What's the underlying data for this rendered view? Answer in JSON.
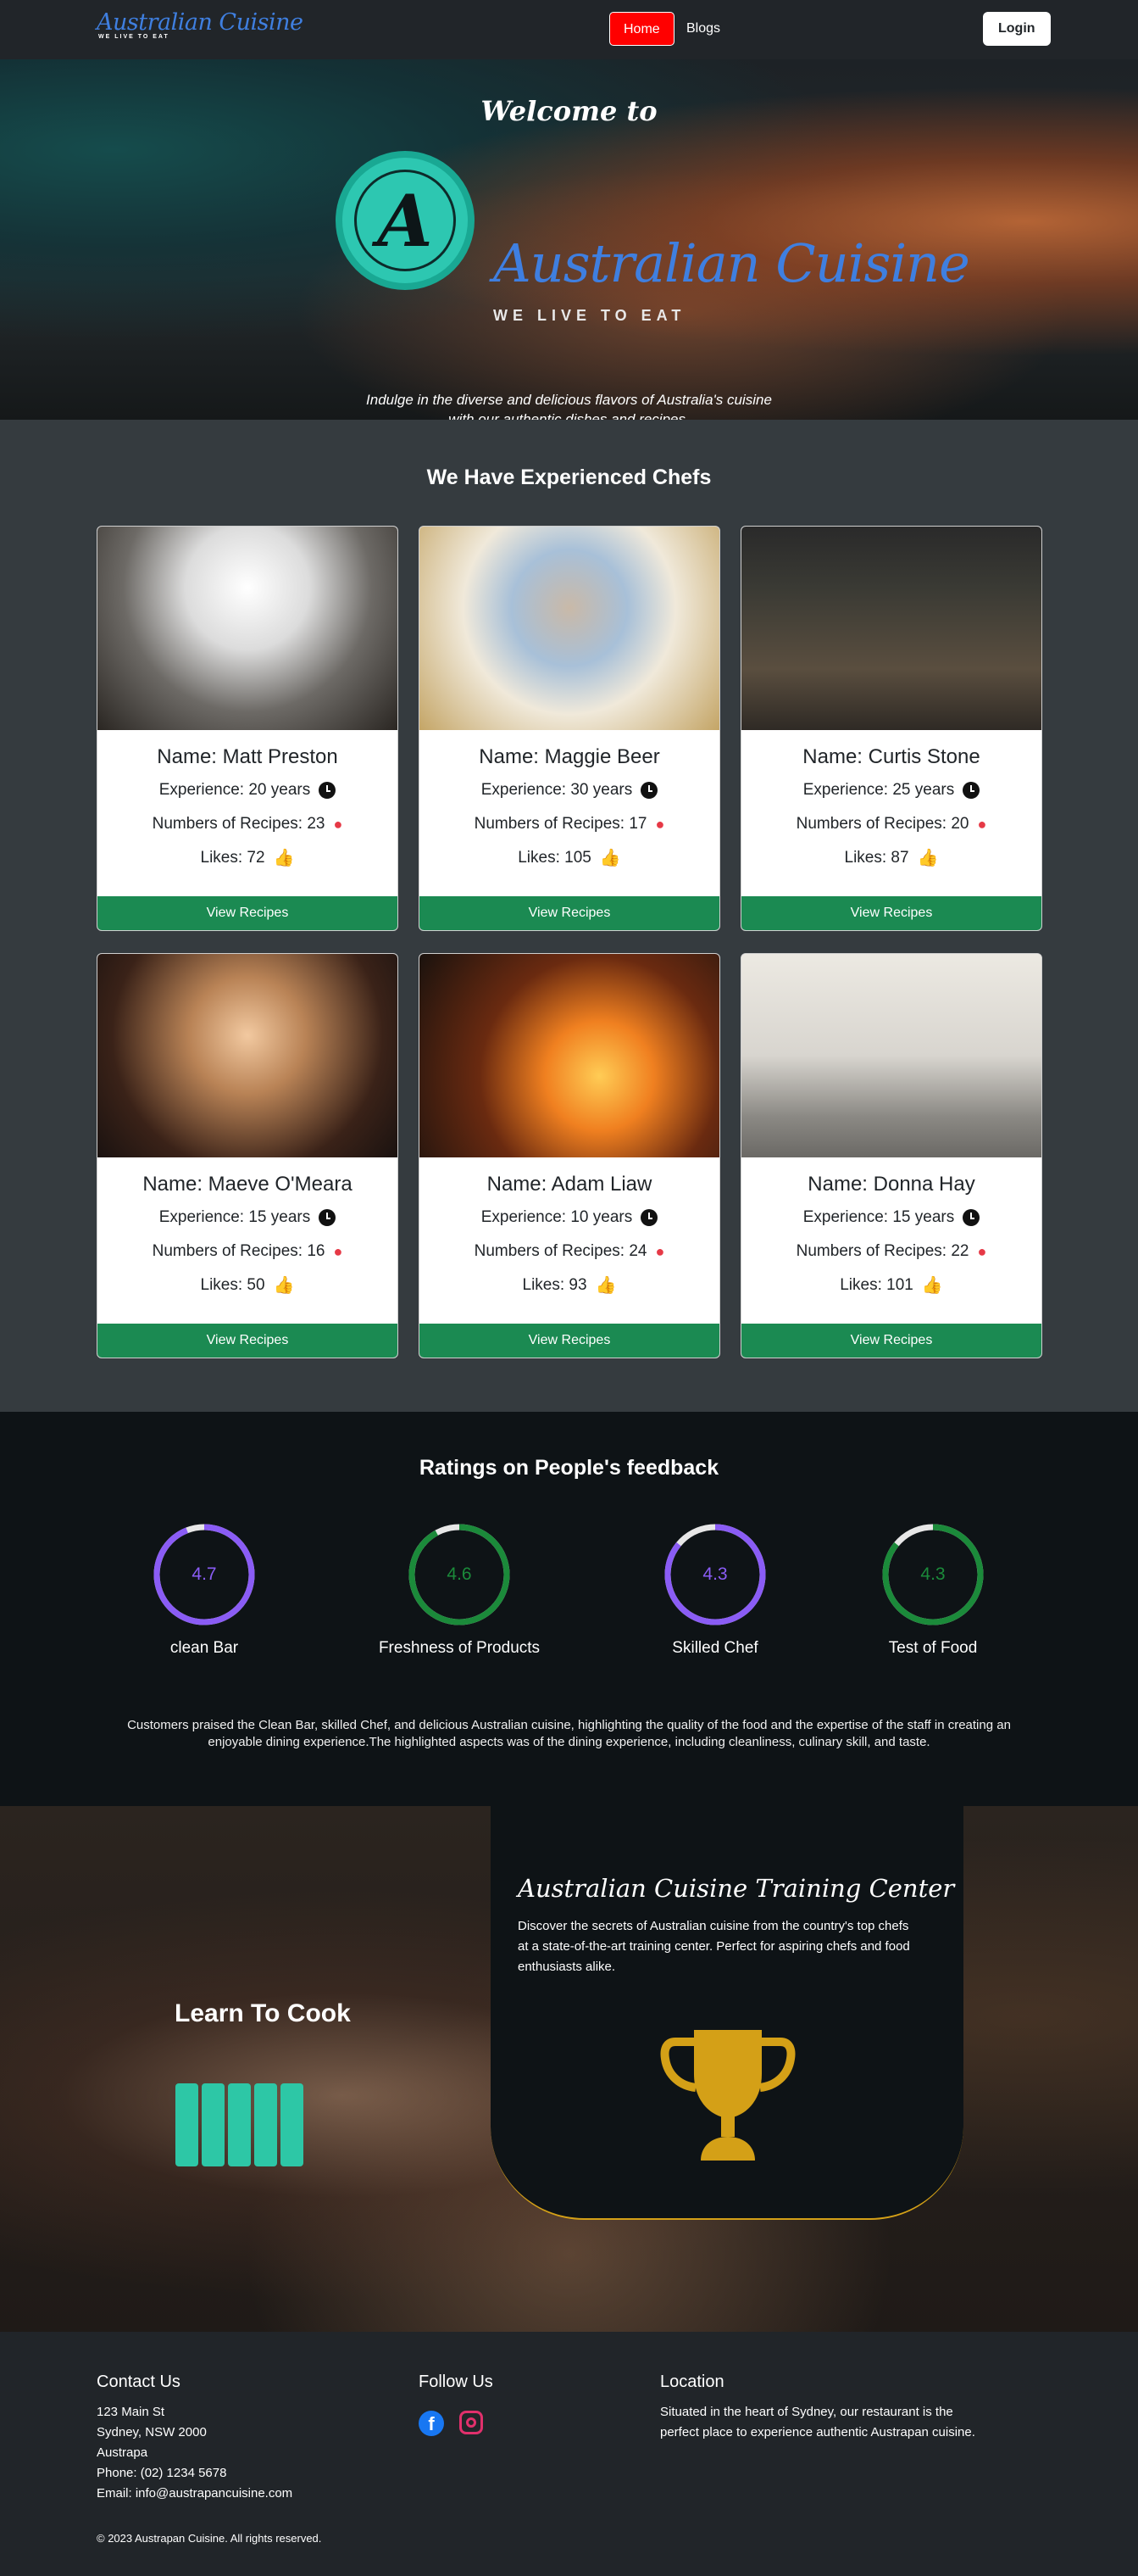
{
  "nav": {
    "brand_name": "Australian Cuisine",
    "brand_tag": "WE LIVE TO EAT",
    "home": "Home",
    "blogs": "Blogs",
    "login": "Login"
  },
  "hero": {
    "welcome": "Welcome to",
    "logo_letter": "A",
    "name": "Australian Cuisine",
    "tagline": "WE LIVE TO EAT",
    "desc_line1": "Indulge in the diverse and delicious flavors of Australia's cuisine",
    "desc_line2": "with our authentic dishes and recipes."
  },
  "chefs": {
    "title": "We Have Experienced Chefs",
    "button": "View Recipes",
    "items": [
      {
        "name": "Name: Matt Preston",
        "experience": "Experience: 20 years",
        "recipes": "Numbers of Recipes: 23",
        "likes": "Likes: 72"
      },
      {
        "name": "Name: Maggie Beer",
        "experience": "Experience: 30 years",
        "recipes": "Numbers of Recipes: 17",
        "likes": "Likes: 105"
      },
      {
        "name": "Name: Curtis Stone",
        "experience": "Experience: 25 years",
        "recipes": "Numbers of Recipes: 20",
        "likes": "Likes: 87"
      },
      {
        "name": "Name: Maeve O'Meara",
        "experience": "Experience: 15 years",
        "recipes": "Numbers of Recipes: 16",
        "likes": "Likes: 50"
      },
      {
        "name": "Name: Adam Liaw",
        "experience": "Experience: 10 years",
        "recipes": "Numbers of Recipes: 24",
        "likes": "Likes: 93"
      },
      {
        "name": "Name: Donna Hay",
        "experience": "Experience: 15 years",
        "recipes": "Numbers of Recipes: 22",
        "likes": "Likes: 101"
      }
    ]
  },
  "ratings": {
    "title": "Ratings on People's feedback",
    "items": [
      {
        "value": "4.7",
        "fraction": 0.94,
        "label": "clean Bar",
        "color": "#8a5cf5"
      },
      {
        "value": "4.6",
        "fraction": 0.92,
        "label": "Freshness of Products",
        "color": "#1b8a3a"
      },
      {
        "value": "4.3",
        "fraction": 0.86,
        "label": "Skilled Chef",
        "color": "#8a5cf5"
      },
      {
        "value": "4.3",
        "fraction": 0.86,
        "label": "Test of Food",
        "color": "#1b8a3a"
      }
    ],
    "description": "Customers praised the Clean Bar, skilled Chef, and delicious Australian cuisine, highlighting the quality of the food and the expertise of the staff in creating an enjoyable dining experience.The highlighted aspects was of the dining experience, including cleanliness, culinary skill, and taste."
  },
  "training": {
    "learn": "Learn To Cook",
    "title": "Australian Cuisine Training Center",
    "text": "Discover the secrets of Australian cuisine from the country's top chefs at a state-of-the-art training center. Perfect for aspiring chefs and food enthusiasts alike.",
    "accent": "#d4a017"
  },
  "footer": {
    "contact_title": "Contact Us",
    "address1": "123 Main St",
    "address2": "Sydney, NSW 2000",
    "address3": "Austrapa",
    "phone": "Phone: (02) 1234 5678",
    "email": "Email: info@austrapancuisine.com",
    "follow_title": "Follow Us",
    "location_title": "Location",
    "location_text": "Situated in the heart of Sydney, our restaurant is the perfect place to experience authentic Austrapan cuisine.",
    "copyright": "© 2023 Austrapan Cuisine. All rights reserved."
  }
}
